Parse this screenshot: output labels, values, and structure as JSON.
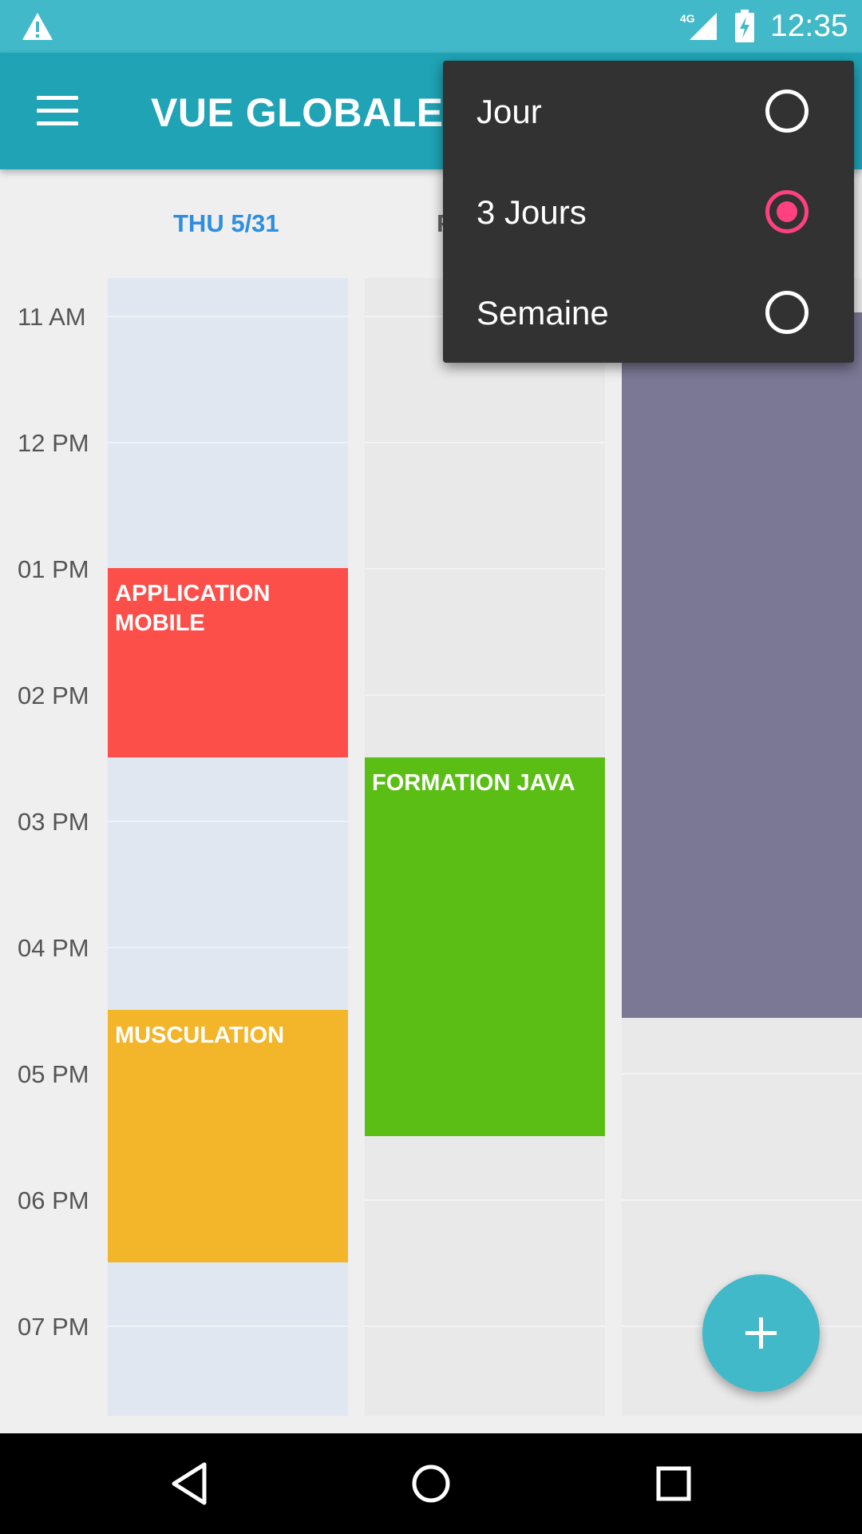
{
  "status_bar": {
    "time": "12:35",
    "network": "4G",
    "icons": [
      "warning-icon",
      "signal-icon",
      "battery-charging-icon"
    ]
  },
  "app_bar": {
    "title": "VUE GLOBALE",
    "menu_icon": "hamburger-menu-icon"
  },
  "calendar": {
    "day_headers": [
      {
        "label": "THU 5/31",
        "today": true
      },
      {
        "label": "F",
        "today": false
      }
    ],
    "hours": [
      "11 AM",
      "12 PM",
      "01 PM",
      "02 PM",
      "03 PM",
      "04 PM",
      "05 PM",
      "06 PM",
      "07 PM"
    ],
    "events": [
      {
        "title": "APPLICATION MOBILE",
        "column": 0,
        "color": "#fd4f49"
      },
      {
        "title": "FORMATION JAVA",
        "column": 1,
        "color": "#5abe14"
      },
      {
        "title": "MUSCULATION",
        "column": 0,
        "color": "#f3b52a"
      },
      {
        "title": "",
        "column": 2,
        "color": "#7a7894"
      }
    ]
  },
  "view_menu": {
    "items": [
      {
        "label": "Jour",
        "checked": false
      },
      {
        "label": "3 Jours",
        "checked": true
      },
      {
        "label": "Semaine",
        "checked": false
      }
    ],
    "accent": "#ff4081"
  },
  "fab": {
    "icon": "plus-icon",
    "color": "#41b9c8"
  },
  "nav_bar": {
    "icons": [
      "back-icon",
      "home-icon",
      "recents-icon"
    ]
  },
  "colors": {
    "status_bar": "#41b9c8",
    "app_bar": "#1fa3b5",
    "today_header": "#2f8ede"
  }
}
